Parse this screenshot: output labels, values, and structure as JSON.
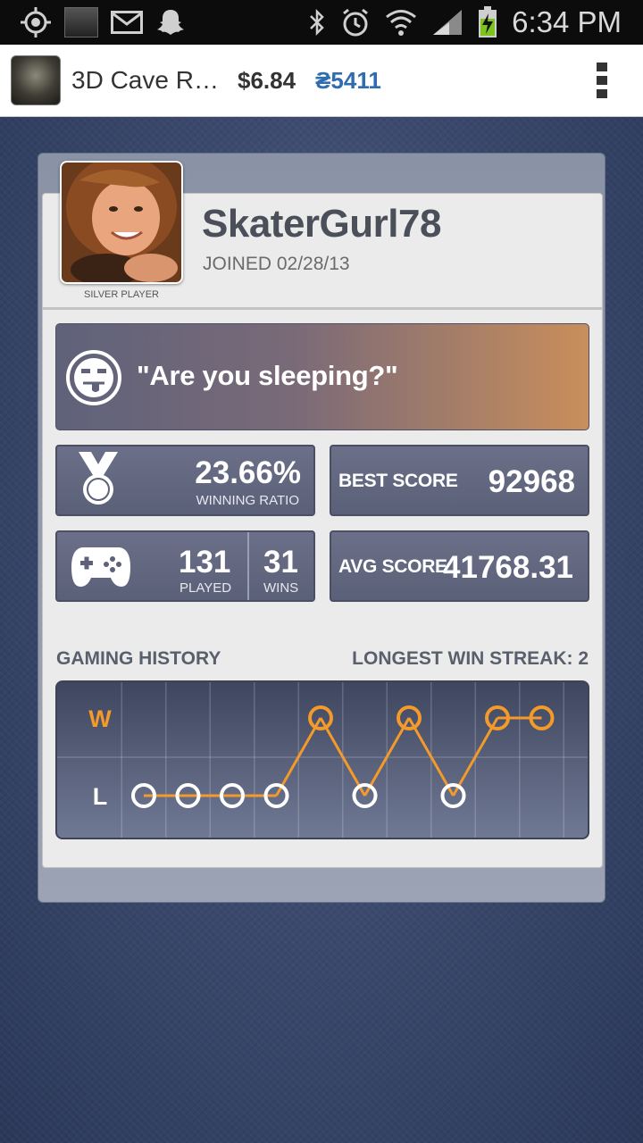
{
  "status_bar": {
    "time": "6:34 PM",
    "icons": [
      "gps-icon",
      "app-thumbnail-icon",
      "mail-icon",
      "snapchat-icon",
      "bluetooth-icon",
      "alarm-icon",
      "wifi-icon",
      "signal-icon",
      "battery-charging-icon"
    ]
  },
  "app_header": {
    "title": "3D Cave R…",
    "price": "$6.84",
    "coins": "₴5411",
    "menu_icon": "overflow-menu-icon"
  },
  "profile": {
    "username": "SkaterGurl78",
    "joined": "JOINED 02/28/13",
    "tier": "SILVER PLAYER"
  },
  "quote": {
    "text": "\"Are you sleeping?\"",
    "icon": "tongue-face-icon"
  },
  "stats": {
    "winning_ratio": "23.66%",
    "winning_ratio_label": "WINNING RATIO",
    "best_score_label": "BEST SCORE",
    "best_score": "92968",
    "played": "131",
    "played_label": "PLAYED",
    "wins": "31",
    "wins_label": "WINS",
    "avg_score_label": "AVG SCORE",
    "avg_score": "41768.31"
  },
  "history": {
    "title": "GAMING HISTORY",
    "streak": "LONGEST WIN STREAK: 2",
    "w_label": "W",
    "l_label": "L"
  },
  "colors": {
    "accent_orange": "#f39a2b",
    "coins_blue": "#2e6db0",
    "tile_bg": "#5d627a"
  },
  "chart_data": {
    "type": "line",
    "x": [
      1,
      2,
      3,
      4,
      5,
      6,
      7,
      8,
      9,
      10
    ],
    "categories": [
      "L",
      "W"
    ],
    "values": [
      "L",
      "L",
      "L",
      "L",
      "W",
      "L",
      "W",
      "L",
      "W",
      "W"
    ],
    "title": "GAMING HISTORY",
    "xlabel": "",
    "ylabel": ""
  }
}
